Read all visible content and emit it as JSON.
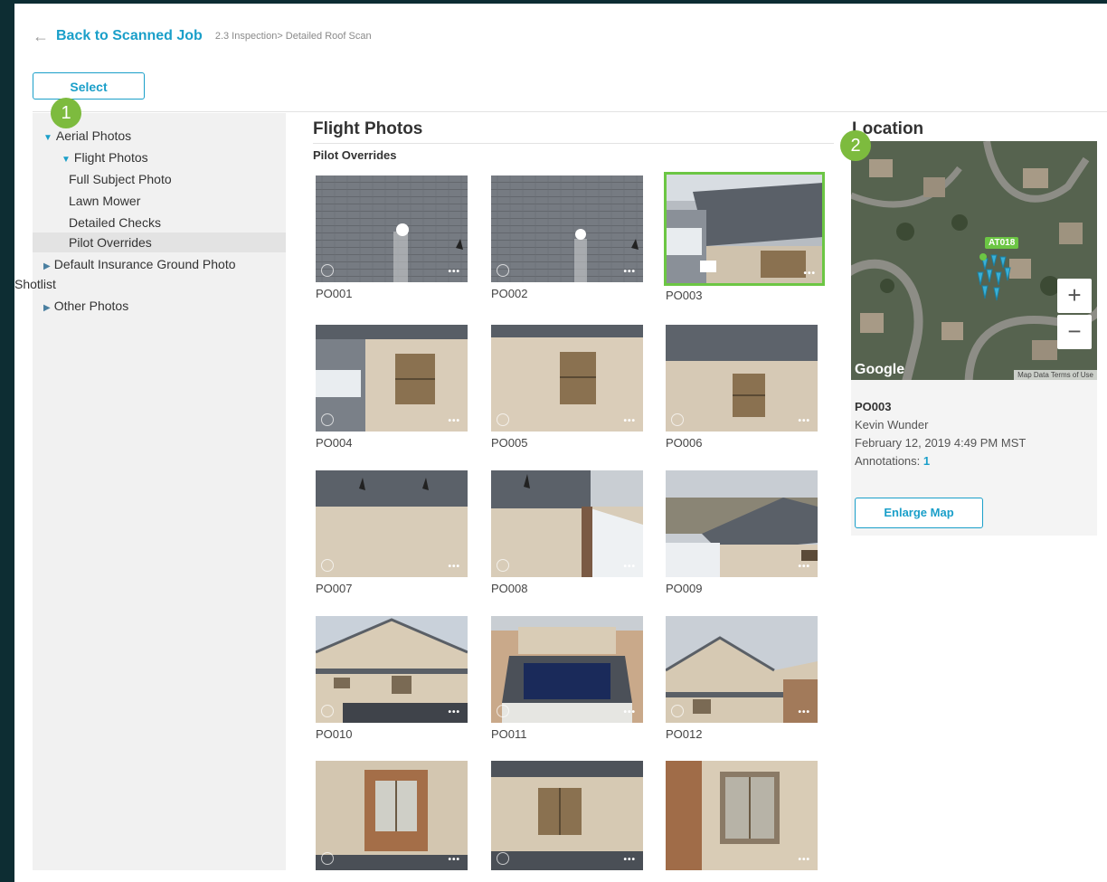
{
  "header": {
    "back_label": "Back to Scanned Job",
    "breadcrumb": "2.3 Inspection> Detailed Roof Scan"
  },
  "select_label": "Select",
  "badges": {
    "one": "1",
    "two": "2"
  },
  "sidebar": {
    "items": [
      {
        "label": "Aerial Photos"
      },
      {
        "label": "Flight Photos"
      },
      {
        "label": "Full Subject Photo"
      },
      {
        "label": "Lawn Mower"
      },
      {
        "label": "Detailed Checks"
      },
      {
        "label": "Pilot Overrides"
      },
      {
        "label": "Default Insurance Ground Photo"
      },
      {
        "label": "Shotlist"
      },
      {
        "label": "Other Photos"
      }
    ]
  },
  "main": {
    "title": "Flight Photos",
    "subtitle": "Pilot Overrides",
    "photos": [
      {
        "label": "PO001"
      },
      {
        "label": "PO002"
      },
      {
        "label": "PO003"
      },
      {
        "label": "PO004"
      },
      {
        "label": "PO005"
      },
      {
        "label": "PO006"
      },
      {
        "label": "PO007"
      },
      {
        "label": "PO008"
      },
      {
        "label": "PO009"
      },
      {
        "label": "PO010"
      },
      {
        "label": "PO011"
      },
      {
        "label": "PO012"
      }
    ],
    "more_glyph": "•••"
  },
  "location": {
    "title": "Location",
    "map_pin_label": "AT018",
    "zoom_in": "+",
    "zoom_out": "−",
    "google_label": "Google",
    "terms_label": "Map Data   Terms of Use",
    "selected_id": "PO003",
    "author": "Kevin Wunder",
    "date": "February 12, 2019 4:49 PM MST",
    "annotations_label": "Annotations: ",
    "annotations_count": "1",
    "enlarge_label": "Enlarge Map"
  },
  "colors": {
    "accent": "#1a9fc9",
    "badge": "#7dbb3e",
    "selected_outline": "#6cc644",
    "frame": "#0d2d33"
  }
}
